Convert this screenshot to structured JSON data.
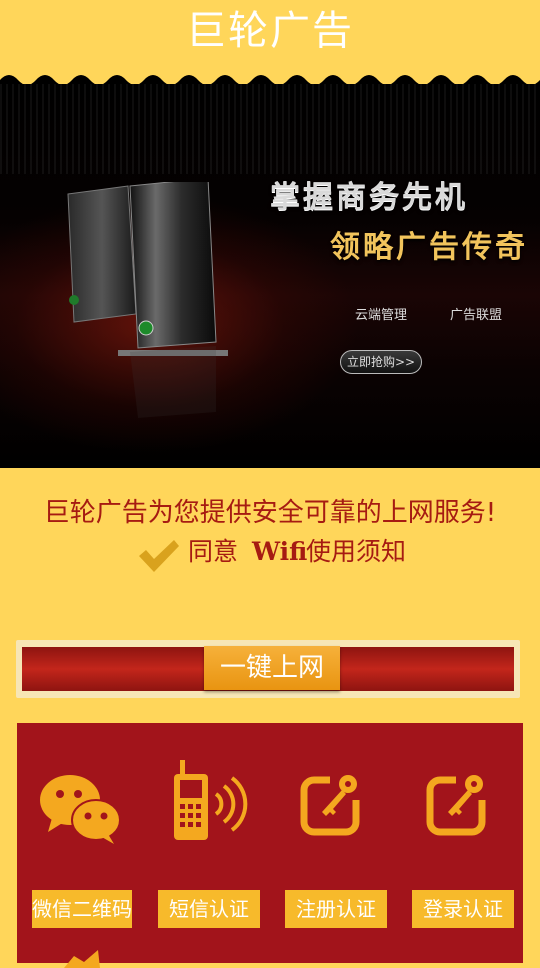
{
  "header": {
    "title": "巨轮广告"
  },
  "banner": {
    "headline1": "掌握商务先机",
    "headline2": "领略广告传奇",
    "links": [
      "云端管理",
      "广告联盟"
    ],
    "buy_button": "立即抢购>>"
  },
  "service_text": "巨轮广告为您提供安全可靠的上网服务!",
  "agreement": {
    "prefix": "同意 ",
    "wifi": "Wifi",
    "suffix": "使用须知"
  },
  "onekey_button": "一键上网",
  "auth_options": [
    {
      "label": "微信二维码",
      "icon": "wechat-icon"
    },
    {
      "label": "短信认证",
      "icon": "phone-signal-icon"
    },
    {
      "label": "注册认证",
      "icon": "key-edit-icon"
    },
    {
      "label": "登录认证",
      "icon": "key-edit-icon"
    }
  ],
  "colors": {
    "background": "#FFD65A",
    "brand_red": "#A2141B",
    "accent_orange": "#F7BA2B",
    "text_red": "#A61B12"
  }
}
